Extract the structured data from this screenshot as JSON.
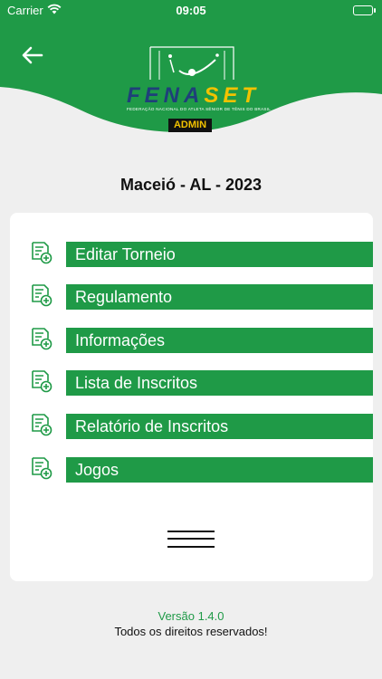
{
  "status_bar": {
    "carrier": "Carrier",
    "time": "09:05"
  },
  "header": {
    "logo_word_a": "FENA",
    "logo_word_b": "SET",
    "logo_subtitle": "FEDERAÇÃO NACIONAL DO ATLETA SÊNIOR DE TÊNIS DO BRASIL",
    "admin_badge": "ADMIN",
    "brand_green": "#1f9a47",
    "brand_navy": "#1f3f7a",
    "brand_yellow": "#f2c200"
  },
  "event": {
    "title": "Maceió - AL - 2023"
  },
  "menu": {
    "items": [
      {
        "label": "Editar Torneio",
        "icon": "document-add-icon"
      },
      {
        "label": "Regulamento",
        "icon": "document-add-icon"
      },
      {
        "label": "Informações",
        "icon": "document-add-icon"
      },
      {
        "label": "Lista de Inscritos",
        "icon": "document-add-icon"
      },
      {
        "label": "Relatório de Inscritos",
        "icon": "document-add-icon"
      },
      {
        "label": "Jogos",
        "icon": "document-add-icon"
      }
    ]
  },
  "footer": {
    "version": "Versão 1.4.0",
    "rights": "Todos os direitos reservados!"
  }
}
